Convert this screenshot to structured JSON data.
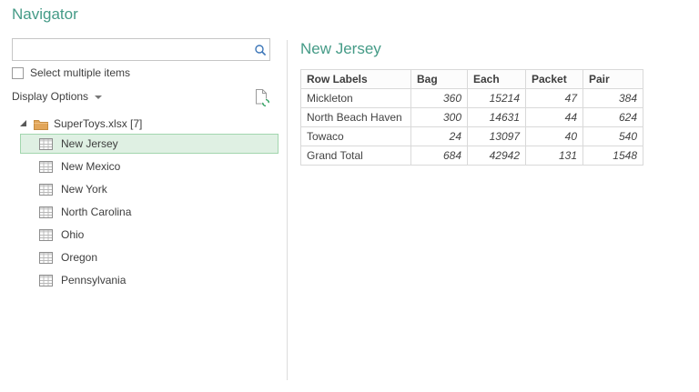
{
  "dialog": {
    "title": "Navigator"
  },
  "left_panel": {
    "search": {
      "value": "",
      "placeholder": ""
    },
    "select_multiple_label": "Select multiple items",
    "display_options_label": "Display Options",
    "tree": {
      "root_label": "SuperToys.xlsx [7]",
      "items": [
        {
          "label": "New Jersey",
          "selected": true
        },
        {
          "label": "New Mexico",
          "selected": false
        },
        {
          "label": "New York",
          "selected": false
        },
        {
          "label": "North Carolina",
          "selected": false
        },
        {
          "label": "Ohio",
          "selected": false
        },
        {
          "label": "Oregon",
          "selected": false
        },
        {
          "label": "Pennsylvania",
          "selected": false
        }
      ]
    }
  },
  "preview": {
    "title": "New Jersey",
    "table": {
      "columns": [
        "Row Labels",
        "Bag",
        "Each",
        "Packet",
        "Pair"
      ],
      "rows": [
        [
          "Mickleton",
          "360",
          "15214",
          "47",
          "384"
        ],
        [
          "North Beach Haven",
          "300",
          "14631",
          "44",
          "624"
        ],
        [
          "Towaco",
          "24",
          "13097",
          "40",
          "540"
        ],
        [
          "Grand Total",
          "684",
          "42942",
          "131",
          "1548"
        ]
      ]
    }
  },
  "icons": {
    "search": "search-icon",
    "refresh_document": "refresh-preview-icon",
    "folder": "folder-icon",
    "worksheet": "worksheet-grid-icon",
    "expand": "expand-triangle-icon",
    "dropdown": "chevron-down-icon"
  },
  "colors": {
    "accent_title": "#459b87",
    "selection_bg": "#dff0e3",
    "selection_border": "#a2d6ae",
    "folder": "#e2a65a",
    "search_icon_blue": "#3c76b8",
    "refresh_green": "#2fa05f",
    "border_gray": "#d9d9d9",
    "text": "#444444"
  }
}
